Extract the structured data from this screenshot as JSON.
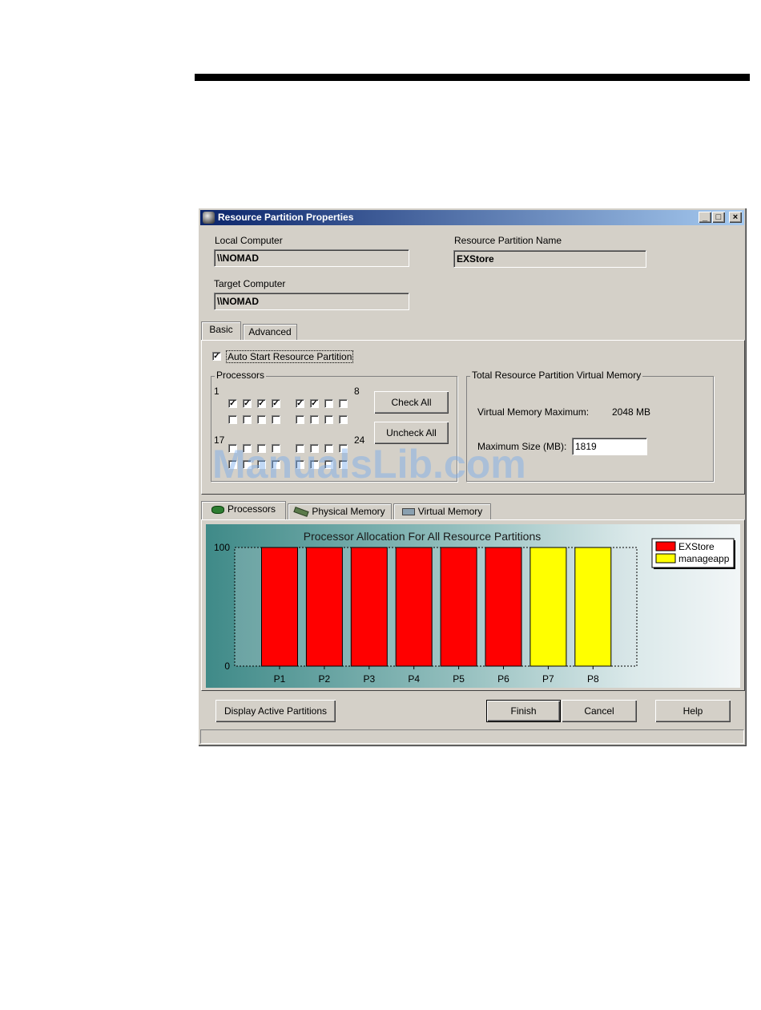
{
  "window": {
    "title": "Resource Partition Properties"
  },
  "fields": {
    "local_computer_label": "Local Computer",
    "local_computer_value": "\\\\NOMAD",
    "target_computer_label": "Target Computer",
    "target_computer_value": "\\\\NOMAD",
    "partition_name_label": "Resource Partition Name",
    "partition_name_value": "EXStore"
  },
  "tabs": [
    {
      "label": "Basic",
      "active": true
    },
    {
      "label": "Advanced",
      "active": false
    }
  ],
  "basic": {
    "auto_start_label": "Auto Start Resource Partition",
    "auto_start_checked": true,
    "processors_group_title": "Processors",
    "label_1": "1",
    "label_8": "8",
    "label_17": "17",
    "label_24": "24",
    "processor_rows": [
      [
        true,
        true,
        true,
        true,
        true,
        true,
        false,
        false
      ],
      [
        false,
        false,
        false,
        false,
        false,
        false,
        false,
        false
      ],
      [
        false,
        false,
        false,
        false,
        false,
        false,
        false,
        false
      ],
      [
        false,
        false,
        false,
        false,
        false,
        false,
        false,
        false
      ]
    ],
    "check_all_label": "Check All",
    "uncheck_all_label": "Uncheck All",
    "vm_group_title": "Total Resource Partition Virtual Memory",
    "vm_max_label": "Virtual Memory Maximum:",
    "vm_max_value": "2048 MB",
    "max_size_label": "Maximum Size (MB):",
    "max_size_value": "1819"
  },
  "lower_tabs": [
    {
      "label": "Processors",
      "icon": "processor-chip-icon",
      "active": true
    },
    {
      "label": "Physical Memory",
      "icon": "memory-module-icon",
      "active": false
    },
    {
      "label": "Virtual Memory",
      "icon": "virtual-memory-icon",
      "active": false
    }
  ],
  "chart_data": {
    "type": "bar",
    "title": "Processor Allocation For All Resource Partitions",
    "categories": [
      "P1",
      "P2",
      "P3",
      "P4",
      "P5",
      "P6",
      "P7",
      "P8"
    ],
    "values": [
      100,
      100,
      100,
      100,
      100,
      100,
      100,
      100
    ],
    "bar_series": [
      "EXStore",
      "EXStore",
      "EXStore",
      "EXStore",
      "EXStore",
      "EXStore",
      "manageapp",
      "manageapp"
    ],
    "series": [
      {
        "name": "EXStore",
        "color": "#ff0000"
      },
      {
        "name": "manageapp",
        "color": "#ffff00"
      }
    ],
    "ylim": [
      0,
      100
    ],
    "y_tick_labels": [
      "100",
      "0"
    ],
    "legend_position": "top-right"
  },
  "buttons": {
    "display_active": "Display Active Partitions",
    "finish": "Finish",
    "cancel": "Cancel",
    "help": "Help"
  },
  "watermark": "ManualsLib.com"
}
